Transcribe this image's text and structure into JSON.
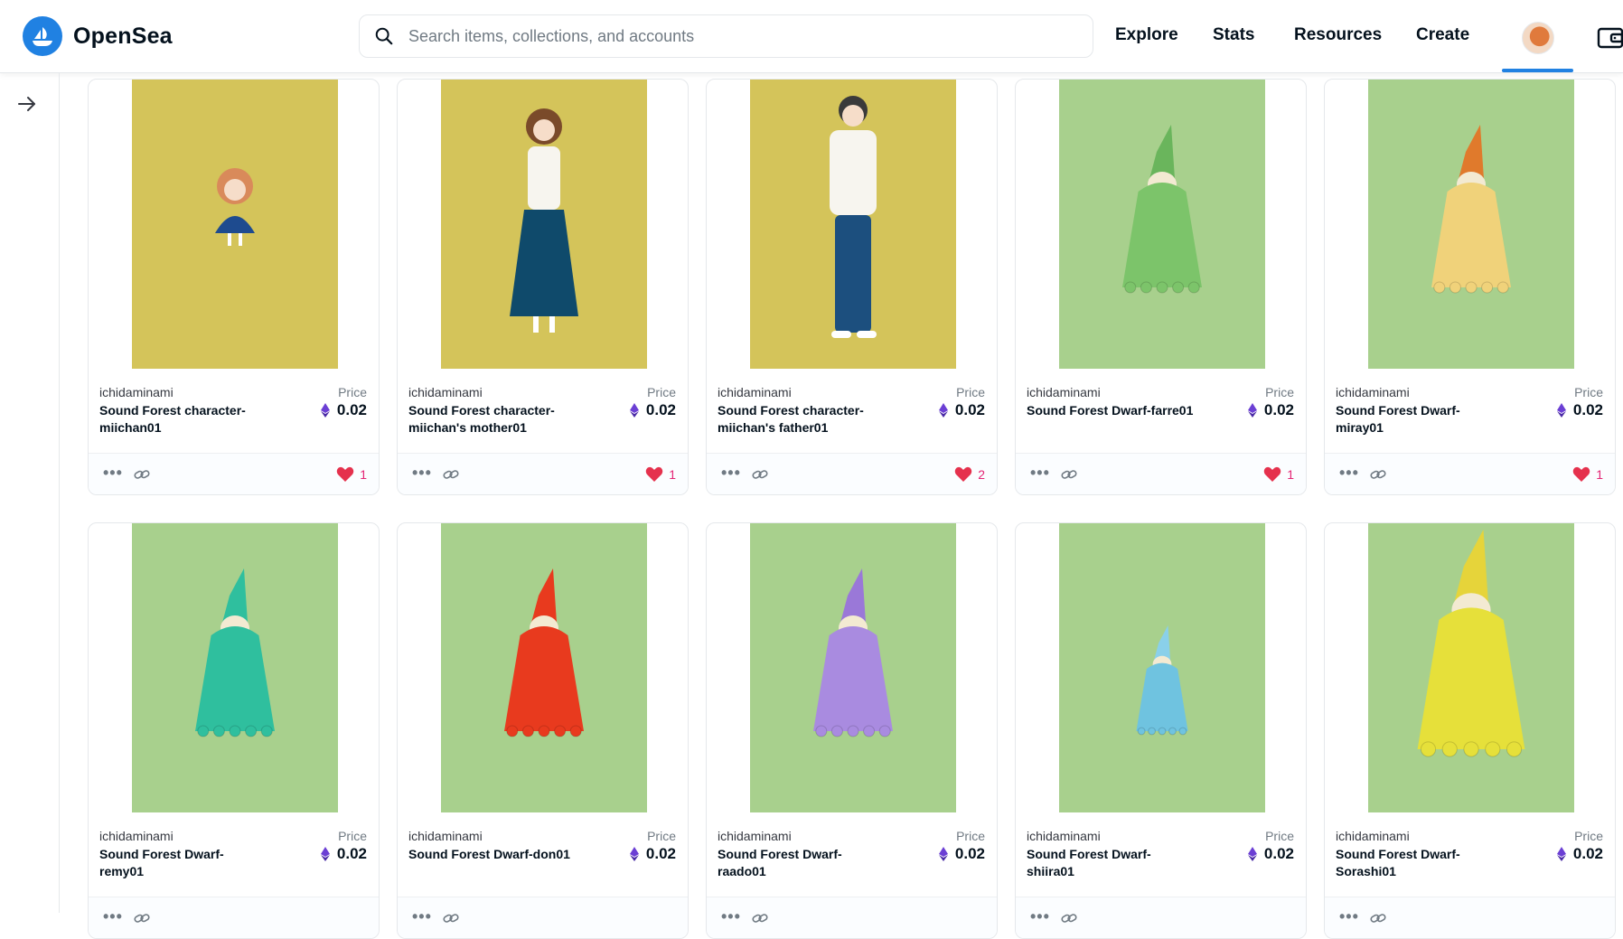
{
  "app": {
    "name": "OpenSea",
    "brand_color": "#2081e2"
  },
  "search": {
    "placeholder": "Search items, collections, and accounts",
    "icon": "search-icon"
  },
  "nav": {
    "explore": "Explore",
    "stats": "Stats",
    "resources": "Resources",
    "create": "Create"
  },
  "header": {
    "profile_icon": "avatar",
    "wallet_icon": "wallet-icon"
  },
  "sidebar": {
    "toggle_icon": "arrow-right-icon"
  },
  "labels": {
    "price": "Price"
  },
  "items": [
    {
      "creator": "ichidaminami",
      "title": "Sound Forest character-miichan01",
      "price": "0.02",
      "likes": "1",
      "bg": "#d4c45a",
      "figure": "girl-blue-dress"
    },
    {
      "creator": "ichidaminami",
      "title": "Sound Forest character-miichan's mother01",
      "price": "0.02",
      "likes": "1",
      "bg": "#d4c45a",
      "figure": "woman-teal-skirt"
    },
    {
      "creator": "ichidaminami",
      "title": "Sound Forest character-miichan's father01",
      "price": "0.02",
      "likes": "2",
      "bg": "#d4c45a",
      "figure": "man-jeans"
    },
    {
      "creator": "ichidaminami",
      "title": "Sound Forest Dwarf-farre01",
      "price": "0.02",
      "likes": "1",
      "bg": "#a8d08d",
      "figure": "dwarf",
      "coat": "#7cc46a",
      "hat": "#6ab55c"
    },
    {
      "creator": "ichidaminami",
      "title": "Sound Forest Dwarf-miray01",
      "price": "0.02",
      "likes": "1",
      "bg": "#a8d08d",
      "figure": "dwarf",
      "coat": "#f0d27a",
      "hat": "#e07a2c"
    },
    {
      "creator": "ichidaminami",
      "title": "Sound Forest Dwarf-remy01",
      "price": "0.02",
      "likes": "",
      "bg": "#a8d08d",
      "figure": "dwarf",
      "coat": "#2fbf9e",
      "hat": "#2fbf9e"
    },
    {
      "creator": "ichidaminami",
      "title": "Sound Forest Dwarf-don01",
      "price": "0.02",
      "likes": "",
      "bg": "#a8d08d",
      "figure": "dwarf",
      "coat": "#e83a1e",
      "hat": "#e83a1e"
    },
    {
      "creator": "ichidaminami",
      "title": "Sound Forest Dwarf-raado01",
      "price": "0.02",
      "likes": "",
      "bg": "#a8d08d",
      "figure": "dwarf",
      "coat": "#a98be0",
      "hat": "#9a78d8"
    },
    {
      "creator": "ichidaminami",
      "title": "Sound Forest Dwarf-shiira01",
      "price": "0.02",
      "likes": "",
      "bg": "#a8d08d",
      "figure": "dwarf-small",
      "coat": "#6fc3e0",
      "hat": "#8ad0ea"
    },
    {
      "creator": "ichidaminami",
      "title": "Sound Forest Dwarf-Sorashi01",
      "price": "0.02",
      "likes": "",
      "bg": "#a8d08d",
      "figure": "dwarf-big",
      "coat": "#e6e03a",
      "hat": "#e6d43a"
    }
  ]
}
